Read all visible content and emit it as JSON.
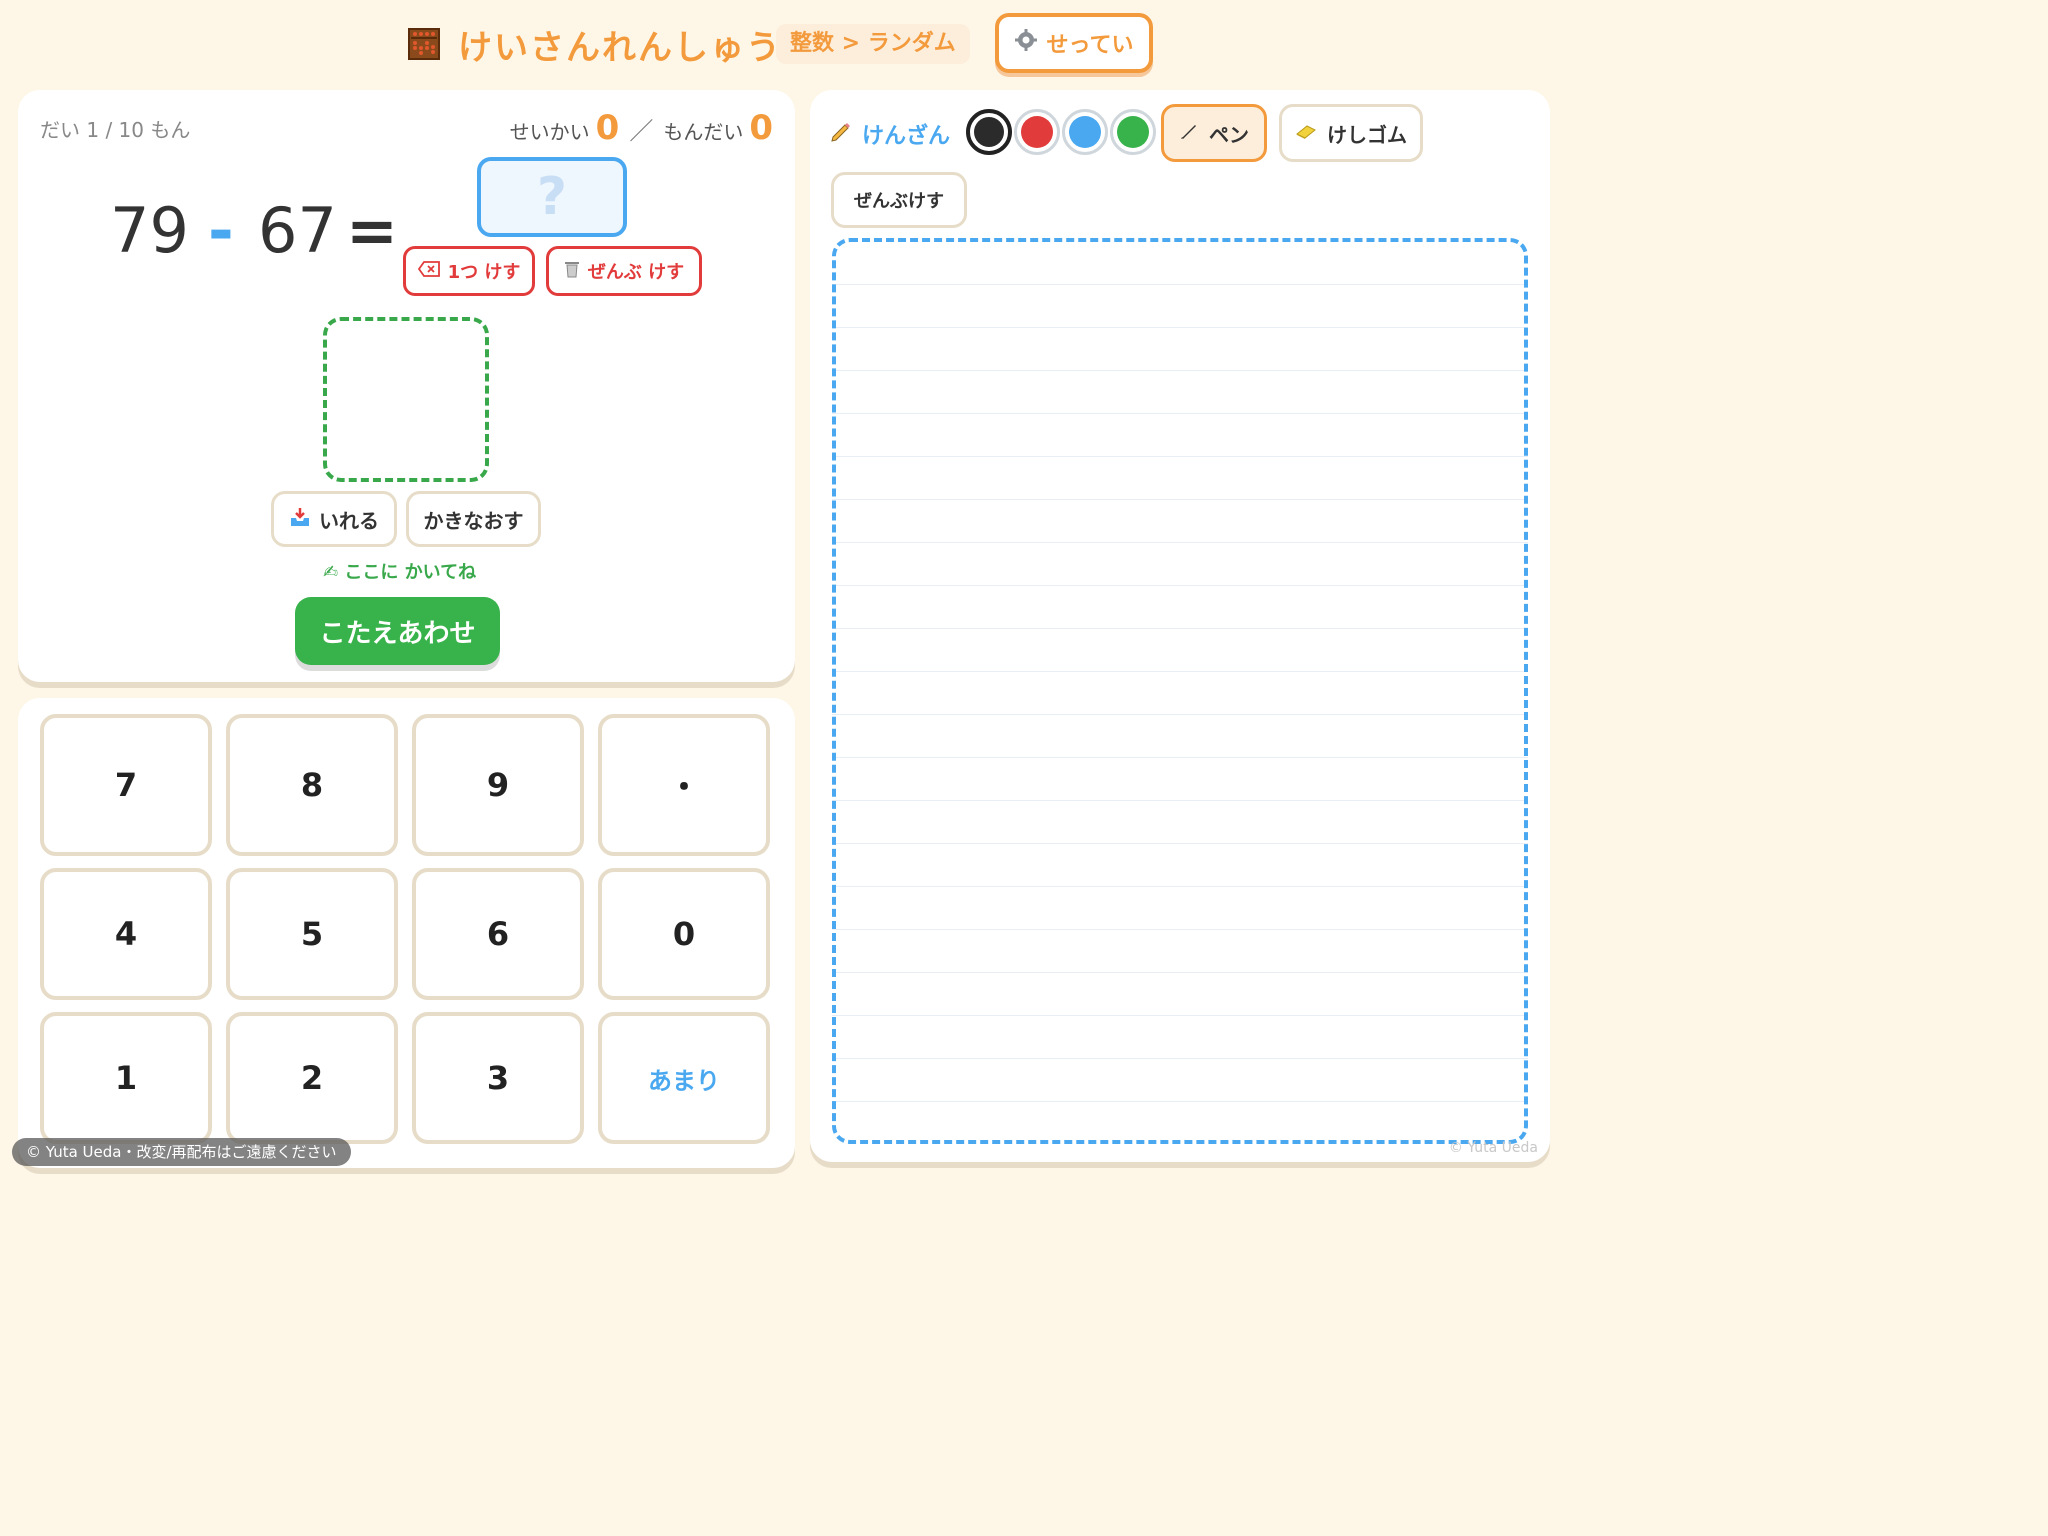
{
  "header": {
    "title": "けいさんれんしゅう",
    "breadcrumb": "整数 > ランダム",
    "settings_label": "せってい"
  },
  "question": {
    "counter": "だい 1 / 10 もん",
    "correct_label": "せいかい",
    "correct_count": "0",
    "total_label": "もんだい",
    "total_count": "0",
    "operand_a": "79",
    "operator": "-",
    "operand_b": "67",
    "equals": "=",
    "answer_placeholder": "?",
    "delete_one_label": "1つ けす",
    "delete_all_label": "ぜんぶ けす",
    "insert_label": "いれる",
    "redo_label": "かきなおす",
    "hint": "ここに かいてね",
    "check_label": "こたえあわせ"
  },
  "keypad": {
    "keys": [
      "7",
      "8",
      "9",
      "・",
      "4",
      "5",
      "6",
      "0",
      "1",
      "2",
      "3",
      "あまり"
    ]
  },
  "memo": {
    "title": "けんざん",
    "colors": [
      "#2b2b2b",
      "#e23b3b",
      "#4aa8f0",
      "#38b24a"
    ],
    "selected_color": "#2b2b2b",
    "pen_label": "ペン",
    "eraser_label": "けしゴム",
    "clear_label": "ぜんぶけす"
  },
  "footer": {
    "copyright": "© Yuta Ueda・改変/再配布はご遠慮ください",
    "watermark": "© Yuta Ueda"
  }
}
